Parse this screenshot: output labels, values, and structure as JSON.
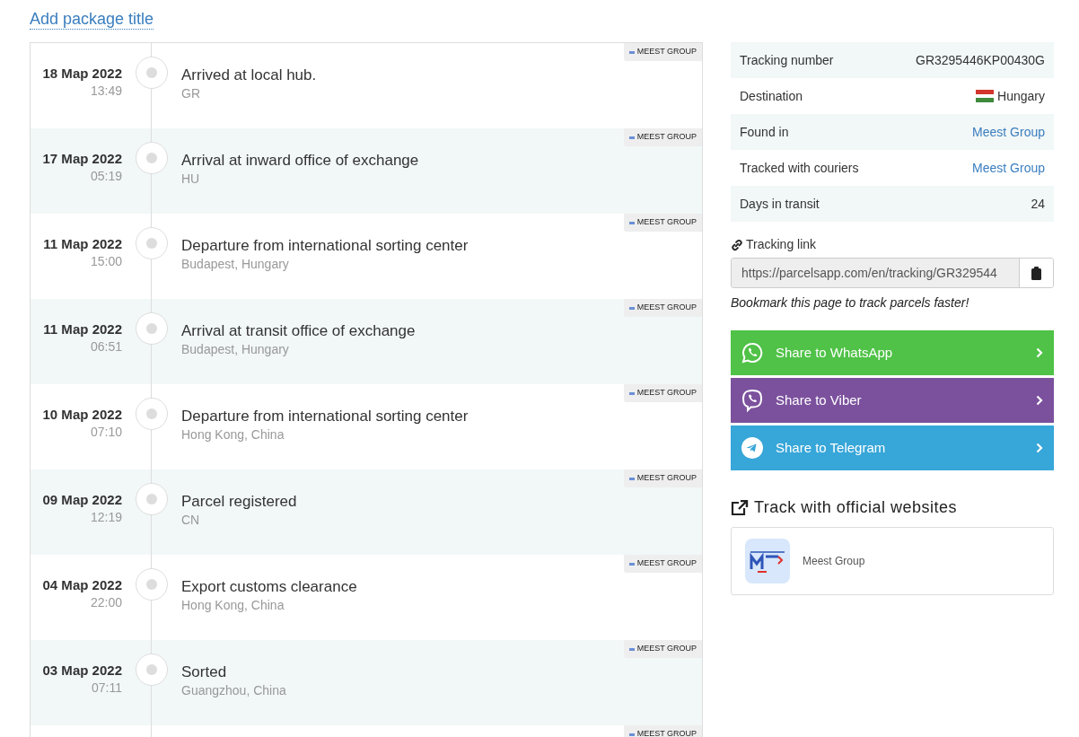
{
  "title_link": "Add package title",
  "events": [
    {
      "date": "18 Мар 2022",
      "time": "13:49",
      "status": "Arrived at local hub.",
      "location": "GR",
      "courier": "MEEST GROUP"
    },
    {
      "date": "17 Мар 2022",
      "time": "05:19",
      "status": "Arrival at inward office of exchange",
      "location": "HU",
      "courier": "MEEST GROUP"
    },
    {
      "date": "11 Мар 2022",
      "time": "15:00",
      "status": "Departure from international sorting center",
      "location": "Budapest, Hungary",
      "courier": "MEEST GROUP"
    },
    {
      "date": "11 Мар 2022",
      "time": "06:51",
      "status": "Arrival at transit office of exchange",
      "location": "Budapest, Hungary",
      "courier": "MEEST GROUP"
    },
    {
      "date": "10 Мар 2022",
      "time": "07:10",
      "status": "Departure from international sorting center",
      "location": "Hong Kong, China",
      "courier": "MEEST GROUP"
    },
    {
      "date": "09 Мар 2022",
      "time": "12:19",
      "status": "Parcel registered",
      "location": "CN",
      "courier": "MEEST GROUP"
    },
    {
      "date": "04 Мар 2022",
      "time": "22:00",
      "status": "Export customs clearance",
      "location": "Hong Kong, China",
      "courier": "MEEST GROUP"
    },
    {
      "date": "03 Мар 2022",
      "time": "07:11",
      "status": "Sorted",
      "location": "Guangzhou, China",
      "courier": "MEEST GROUP"
    },
    {
      "courier": "MEEST GROUP"
    }
  ],
  "info": [
    {
      "kind": "text",
      "label": "Tracking number",
      "value": "GR3295446KP00430G"
    },
    {
      "kind": "flag",
      "label": "Destination",
      "value": "Hungary"
    },
    {
      "kind": "link",
      "label": "Found in",
      "value": "Meest Group"
    },
    {
      "kind": "link",
      "label": "Tracked with couriers",
      "value": "Meest Group"
    },
    {
      "kind": "text",
      "label": "Days in transit",
      "value": "24"
    }
  ],
  "tracking_link": {
    "label": "Tracking link",
    "value": "https://parcelsapp.com/en/tracking/GR329544",
    "hint": "Bookmark this page to track parcels faster!"
  },
  "share": [
    {
      "kind": "whatsapp",
      "label": "Share to WhatsApp",
      "color": "#4fc247"
    },
    {
      "kind": "viber",
      "label": "Share to Viber",
      "color": "#7b519d"
    },
    {
      "kind": "telegram",
      "label": "Share to Telegram",
      "color": "#37a6d8"
    }
  ],
  "official": {
    "title": "Track with official websites",
    "sites": [
      {
        "name": "Meest Group"
      }
    ]
  }
}
